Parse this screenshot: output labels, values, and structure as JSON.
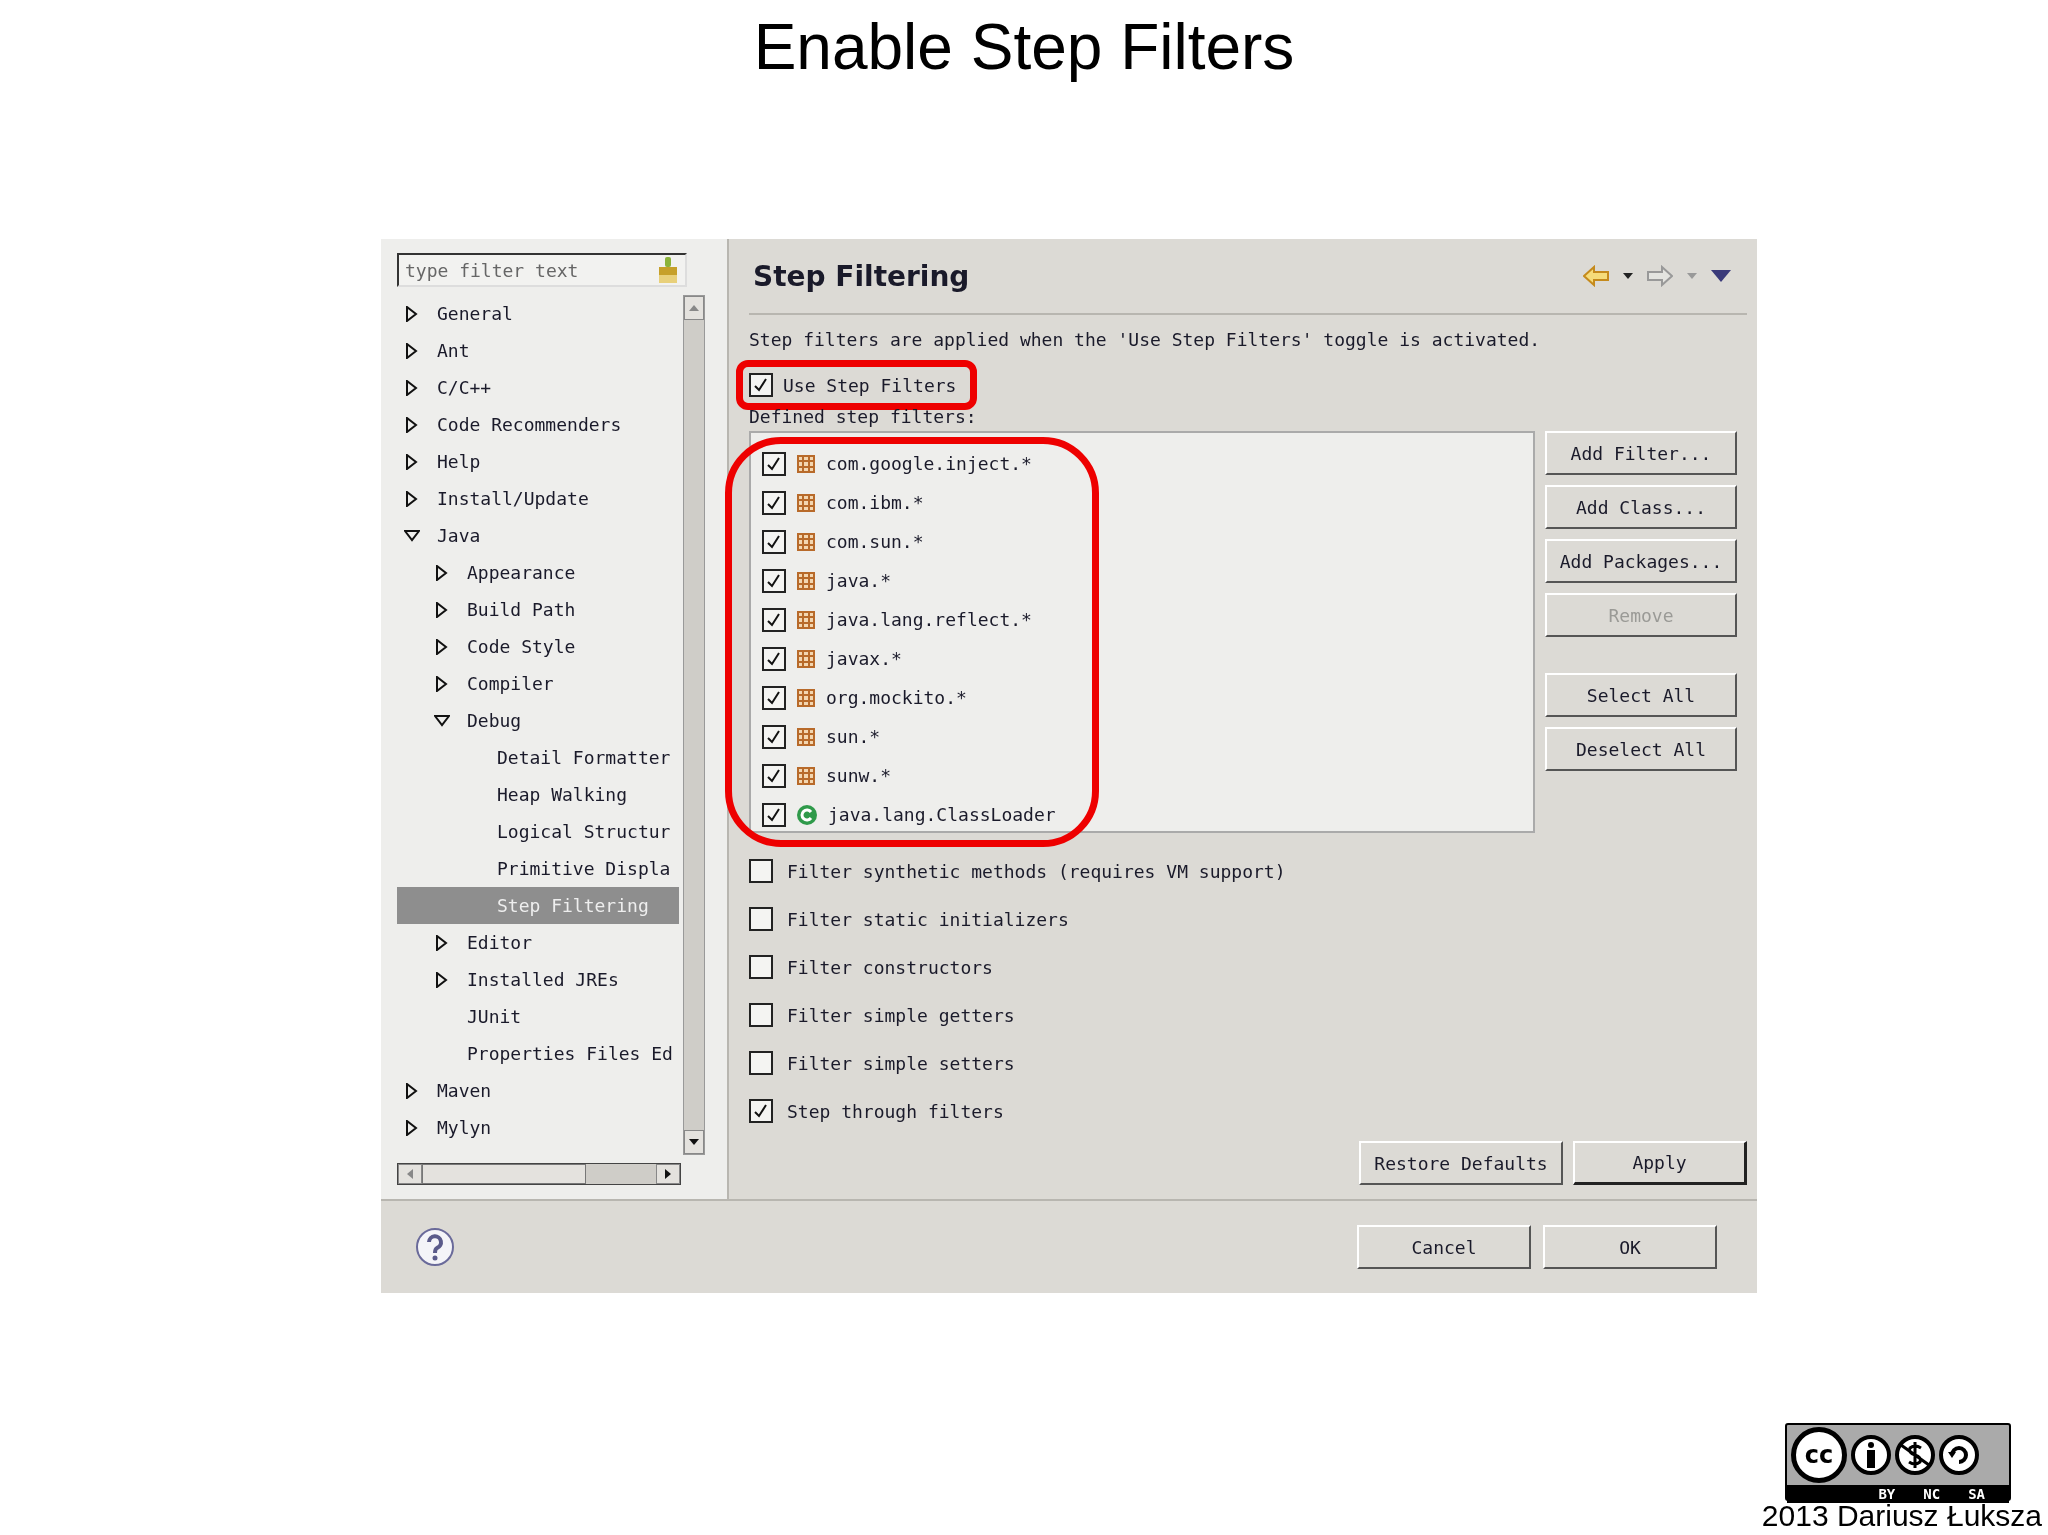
{
  "slide_title": "Enable Step Filters",
  "dialog": {
    "filter_field": {
      "placeholder": "type filter text"
    },
    "tree": [
      {
        "label": "General",
        "kind": "branch",
        "expanded": false,
        "selected": false
      },
      {
        "label": "Ant",
        "kind": "branch",
        "expanded": false,
        "selected": false
      },
      {
        "label": "C/C++",
        "kind": "branch",
        "expanded": false,
        "selected": false
      },
      {
        "label": "Code Recommenders",
        "kind": "branch",
        "expanded": false,
        "selected": false
      },
      {
        "label": "Help",
        "kind": "branch",
        "expanded": false,
        "selected": false
      },
      {
        "label": "Install/Update",
        "kind": "branch",
        "expanded": false,
        "selected": false
      },
      {
        "label": "Java",
        "kind": "branch",
        "expanded": true,
        "selected": false,
        "children": [
          {
            "label": "Appearance",
            "kind": "branch",
            "expanded": false,
            "selected": false
          },
          {
            "label": "Build Path",
            "kind": "branch",
            "expanded": false,
            "selected": false
          },
          {
            "label": "Code Style",
            "kind": "branch",
            "expanded": false,
            "selected": false
          },
          {
            "label": "Compiler",
            "kind": "branch",
            "expanded": false,
            "selected": false
          },
          {
            "label": "Debug",
            "kind": "branch",
            "expanded": true,
            "selected": false,
            "children": [
              {
                "label": "Detail Formatter",
                "kind": "leaf",
                "expanded": false,
                "selected": false
              },
              {
                "label": "Heap Walking",
                "kind": "leaf",
                "expanded": false,
                "selected": false
              },
              {
                "label": "Logical Structur",
                "kind": "leaf",
                "expanded": false,
                "selected": false
              },
              {
                "label": "Primitive Displa",
                "kind": "leaf",
                "expanded": false,
                "selected": false
              },
              {
                "label": "Step Filtering",
                "kind": "leaf",
                "expanded": false,
                "selected": true
              }
            ]
          },
          {
            "label": "Editor",
            "kind": "branch",
            "expanded": false,
            "selected": false
          },
          {
            "label": "Installed JREs",
            "kind": "branch",
            "expanded": false,
            "selected": false
          },
          {
            "label": "JUnit",
            "kind": "leaf",
            "expanded": false,
            "selected": false
          },
          {
            "label": "Properties Files Ed",
            "kind": "leaf",
            "expanded": false,
            "selected": false
          }
        ]
      },
      {
        "label": "Maven",
        "kind": "branch",
        "expanded": false,
        "selected": false
      },
      {
        "label": "Mylyn",
        "kind": "branch",
        "expanded": false,
        "selected": false
      }
    ],
    "page_title": "Step Filtering",
    "description": "Step filters are applied when the 'Use Step Filters' toggle is activated.",
    "use_step_filters": {
      "label": "Use Step Filters",
      "checked": true,
      "highlighted": true
    },
    "filters_label": "Defined step filters:",
    "filters_highlighted": true,
    "filters": [
      {
        "name": "com.google.inject.*",
        "kind": "package",
        "checked": true
      },
      {
        "name": "com.ibm.*",
        "kind": "package",
        "checked": true
      },
      {
        "name": "com.sun.*",
        "kind": "package",
        "checked": true
      },
      {
        "name": "java.*",
        "kind": "package",
        "checked": true
      },
      {
        "name": "java.lang.reflect.*",
        "kind": "package",
        "checked": true
      },
      {
        "name": "javax.*",
        "kind": "package",
        "checked": true
      },
      {
        "name": "org.mockito.*",
        "kind": "package",
        "checked": true
      },
      {
        "name": "sun.*",
        "kind": "package",
        "checked": true
      },
      {
        "name": "sunw.*",
        "kind": "package",
        "checked": true
      },
      {
        "name": "java.lang.ClassLoader",
        "kind": "class",
        "checked": true
      }
    ],
    "side_buttons": [
      {
        "label": "Add Filter...",
        "disabled": false,
        "kind": "edit"
      },
      {
        "label": "Add Class...",
        "disabled": false,
        "kind": "edit"
      },
      {
        "label": "Add Packages...",
        "disabled": false,
        "kind": "edit"
      },
      {
        "label": "Remove",
        "disabled": true,
        "kind": "edit"
      },
      {
        "label": "Select All",
        "disabled": false,
        "kind": "selection"
      },
      {
        "label": "Deselect All",
        "disabled": false,
        "kind": "selection"
      }
    ],
    "options": [
      {
        "label": "Filter synthetic methods (requires VM support)",
        "checked": false
      },
      {
        "label": "Filter static initializers",
        "checked": false
      },
      {
        "label": "Filter constructors",
        "checked": false
      },
      {
        "label": "Filter simple getters",
        "checked": false
      },
      {
        "label": "Filter simple setters",
        "checked": false
      },
      {
        "label": "Step through filters",
        "checked": true
      }
    ],
    "page_buttons": [
      "Restore Defaults",
      "Apply"
    ],
    "dialog_buttons": [
      "Cancel",
      "OK"
    ]
  },
  "license": {
    "labels": [
      "cc",
      "BY",
      "NC",
      "SA"
    ]
  },
  "footer": "2013 Dariusz Łuksza"
}
